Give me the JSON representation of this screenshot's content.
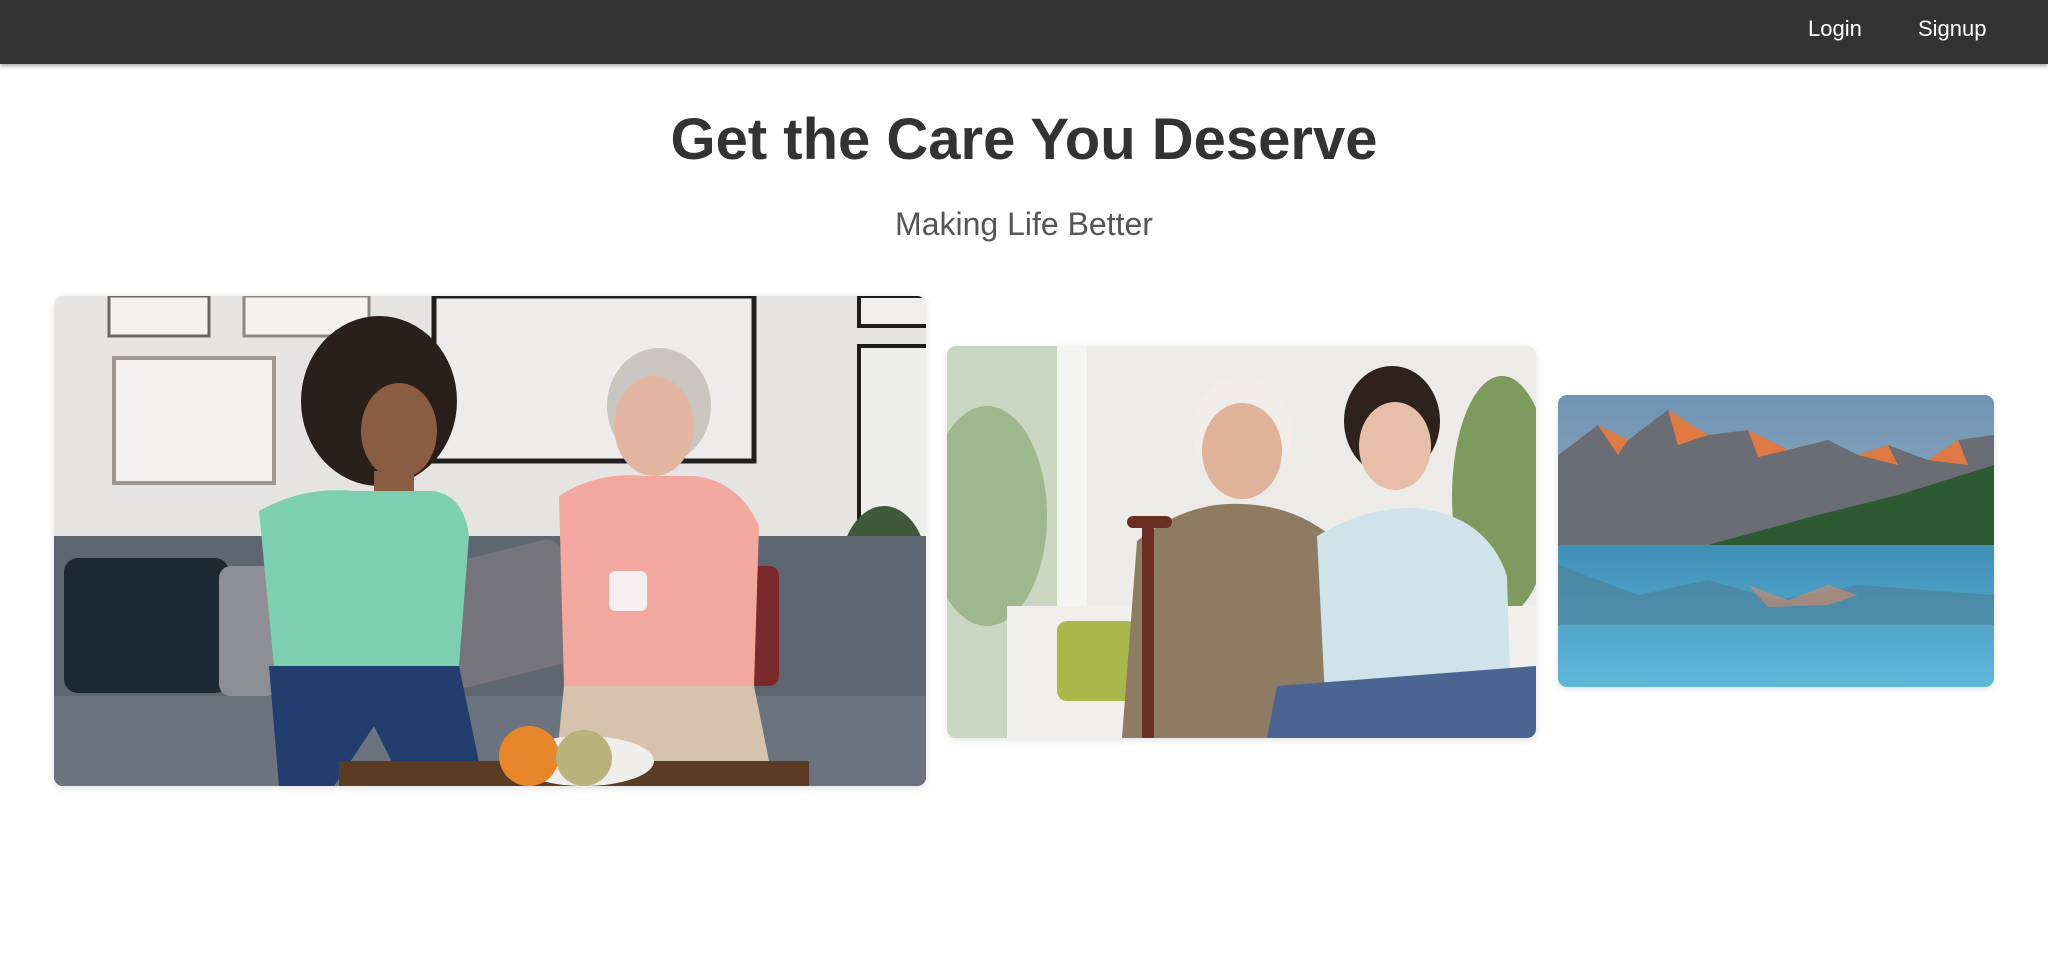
{
  "navbar": {
    "login_label": "Login",
    "signup_label": "Signup",
    "background": "#333333"
  },
  "hero": {
    "title": "Get the Care You Deserve",
    "subtitle": "Making Life Better"
  },
  "gallery": {
    "images": [
      {
        "name": "two-women-conversation-photo",
        "subject": "two women chatting on a couch"
      },
      {
        "name": "elderly-man-caregiver-photo",
        "subject": "elderly man with cane and young woman"
      },
      {
        "name": "mountain-lake-photo",
        "subject": "mountain lake landscape"
      }
    ]
  }
}
